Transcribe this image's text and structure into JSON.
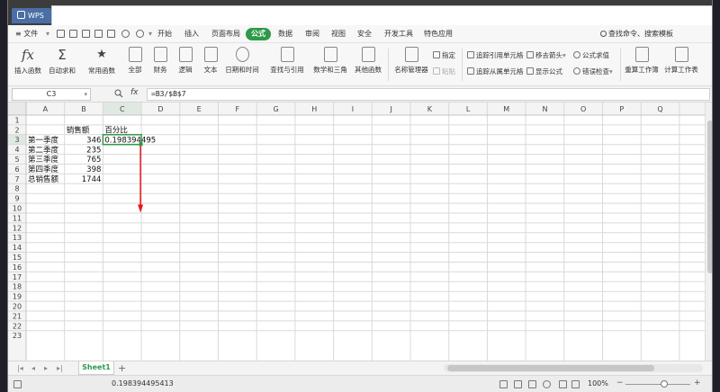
{
  "titlebar": {
    "app_name": "WPS"
  },
  "menu": {
    "file_label": "≡ 文件",
    "tabs": [
      "开始",
      "插入",
      "页面布局",
      "公式",
      "数据",
      "审阅",
      "视图",
      "安全",
      "开发工具",
      "特色应用"
    ],
    "active_tab": "公式",
    "search_label": "查找命令、搜索模板"
  },
  "ribbon": {
    "insert_function": "插入函数",
    "autosum": "自动求和",
    "common_functions": "常用函数",
    "all": "全部",
    "financial": "财务",
    "logical": "逻辑",
    "text": "文本",
    "datetime": "日期和时间",
    "lookup": "查找与引用",
    "math_trig": "数学和三角",
    "other_functions": "其他函数",
    "name_manager": "名称管理器",
    "specify": "指定",
    "paste": "粘贴",
    "trace_precedents": "追踪引用单元格",
    "trace_dependents": "追踪从属单元格",
    "remove_arrows": "移去箭头",
    "show_formulas": "显示公式",
    "evaluate_formula": "公式求值",
    "error_check": "错误检查",
    "recalc_workbook": "重算工作簿",
    "calc_sheet": "计算工作表",
    "dropdown_glyph": "▾",
    "fx_glyph": "fx",
    "sigma_glyph": "Σ",
    "star_glyph": "★"
  },
  "formula_bar": {
    "cell_ref": "C3",
    "fx": "fx",
    "formula": "=B3/$B$7"
  },
  "columns": [
    "A",
    "B",
    "C",
    "D",
    "E",
    "F",
    "G",
    "H",
    "I",
    "J",
    "K",
    "L",
    "M",
    "N",
    "O",
    "P",
    "Q"
  ],
  "row_count": 23,
  "selected_cell": "C3",
  "cells": [
    {
      "ref": "B2",
      "value": "销售额",
      "align": "left"
    },
    {
      "ref": "C2",
      "value": "百分比",
      "align": "left"
    },
    {
      "ref": "A3",
      "value": "第一季度",
      "align": "left"
    },
    {
      "ref": "B3",
      "value": "346",
      "align": "right"
    },
    {
      "ref": "C3",
      "value": "0.198394495",
      "align": "left"
    },
    {
      "ref": "A4",
      "value": "第二季度",
      "align": "left"
    },
    {
      "ref": "B4",
      "value": "235",
      "align": "right"
    },
    {
      "ref": "A5",
      "value": "第三季度",
      "align": "left"
    },
    {
      "ref": "B5",
      "value": "765",
      "align": "right"
    },
    {
      "ref": "A6",
      "value": "第四季度",
      "align": "left"
    },
    {
      "ref": "B6",
      "value": "398",
      "align": "right"
    },
    {
      "ref": "A7",
      "value": "总销售额",
      "align": "left"
    },
    {
      "ref": "B7",
      "value": "1744",
      "align": "right"
    }
  ],
  "annotation": {
    "arrow_color": "#e8141b",
    "from_cell": "C3",
    "to_row": 10
  },
  "sheets": {
    "tabs": [
      "Sheet1"
    ],
    "add_glyph": "+"
  },
  "statusbar": {
    "value": "0.198394495413",
    "zoom": "100%",
    "zoom_level_pct": 60,
    "minus": "−",
    "plus": "+"
  },
  "colors": {
    "accent": "#2e9a49",
    "selection_border": "#2e9a49",
    "header_bg": "#f4f4f4",
    "grid": "#d9d9d9"
  }
}
